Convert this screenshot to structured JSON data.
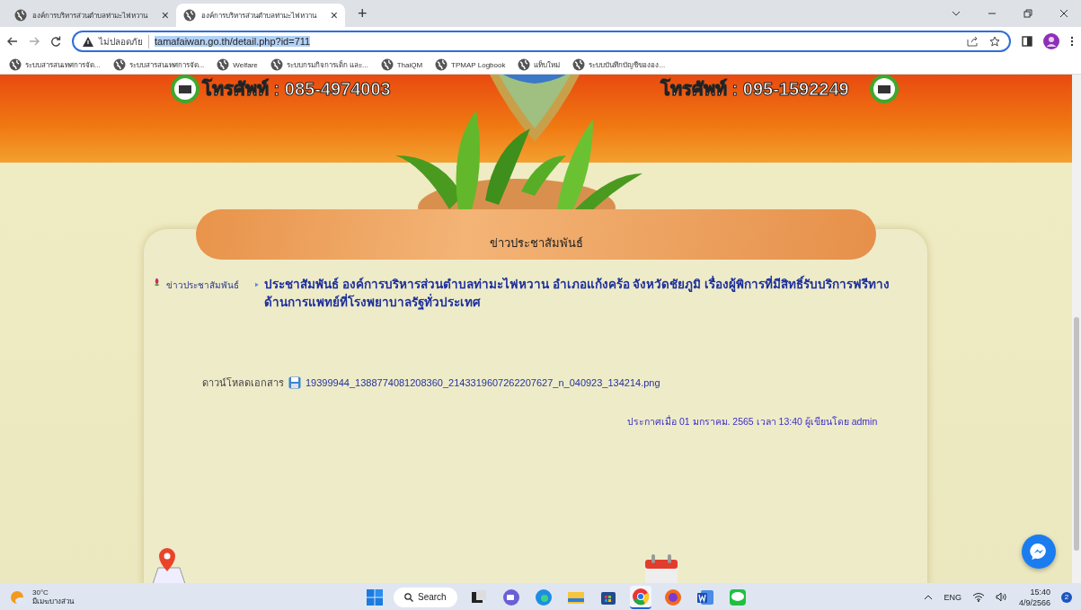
{
  "browser": {
    "tabs": [
      {
        "title": "องค์การบริหารส่วนตำบลท่ามะไฟหวาน",
        "close": "×",
        "selected": false
      },
      {
        "title": "องค์การบริหารส่วนตำบลท่ามะไฟหวาน",
        "close": "×",
        "selected": true
      }
    ],
    "new_tab": "+",
    "address": {
      "security": "ไม่ปลอดภัย",
      "url": "tamafaiwan.go.th/detail.php?id=711"
    },
    "bookmarks": [
      {
        "label": "ระบบสารสนเทศการจัด..."
      },
      {
        "label": "ระบบสารสนเทศการจัด..."
      },
      {
        "label": "Welfare"
      },
      {
        "label": "ระบบกรมกิจการเด็ก และ..."
      },
      {
        "label": "ThaiQM"
      },
      {
        "label": "TPMAP Logbook"
      },
      {
        "label": "แท็บใหม่"
      },
      {
        "label": "ระบบบันทึกบัญชีขององ..."
      }
    ]
  },
  "page": {
    "header": {
      "phone_left": "โทรศัพท์ : 085-4974003",
      "phone_right": "โทรศัพท์ : 095-1592249"
    },
    "section_title": "ข่าวประชาสัมพันธ์",
    "breadcrumb": {
      "category": "ข่าวประชาสัมพันธ์",
      "title": "ประชาสัมพันธ์ องค์การบริหารส่วนตำบลท่ามะไฟหวาน อำเภอแก้งคร้อ จังหวัดชัยภูมิ เรื่องผู้พิการที่มีสิทธิ์รับบริการฟรีทางด้านการแพทย์ที่โรงพยาบาลรัฐทั่วประเทศ"
    },
    "download": {
      "label": "ดาวน์โหลดเอกสาร",
      "file": "19399944_1388774081208360_2143319607262207627_n_040923_134214.png"
    },
    "posted": "ประกาศเมื่อ 01 มกราคม. 2565 เวลา 13:40 ผู้เขียนโดย admin"
  },
  "taskbar": {
    "weather": {
      "temp": "30°C",
      "condition": "มีเมฆบางส่วน"
    },
    "search": "Search",
    "apps": [
      {
        "kind": "taskview",
        "selected": false
      },
      {
        "kind": "meet",
        "selected": false
      },
      {
        "kind": "edge",
        "selected": false
      },
      {
        "kind": "files",
        "selected": false
      },
      {
        "kind": "store",
        "selected": false
      },
      {
        "kind": "chrome",
        "selected": true
      },
      {
        "kind": "firefox",
        "selected": false
      },
      {
        "kind": "word",
        "selected": false
      },
      {
        "kind": "line",
        "selected": false
      }
    ],
    "language": "ENG",
    "time": "15:40",
    "date": "4/9/2566",
    "notifications": "2"
  }
}
